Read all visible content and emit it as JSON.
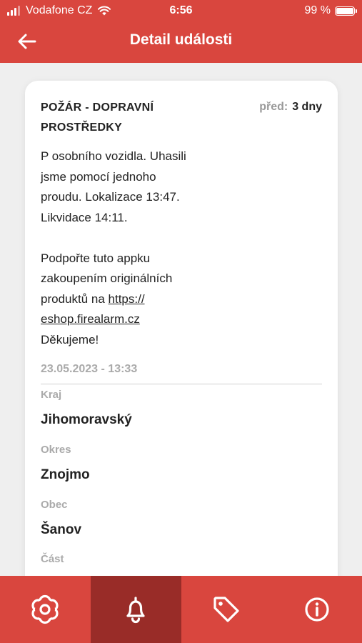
{
  "status_bar": {
    "carrier": "Vodafone CZ",
    "time": "6:56",
    "battery": "99 %",
    "battery_level": 0.99
  },
  "header": {
    "title": "Detail události"
  },
  "event": {
    "title": "POŽÁR - DOPRAVNÍ PROSTŘEDKY",
    "ago_label": "před:",
    "ago_value": "3 dny",
    "description_lines": [
      "P osobního vozidla. Uhasili",
      "jsme pomocí jednoho",
      "proudu. Lokalizace 13:47.",
      "Likvidace 14:11."
    ],
    "promo_lines": [
      "Podpořte tuto appku",
      "zakoupením originálních"
    ],
    "promo_pre_link": "produktů na ",
    "promo_link_part1": "https://",
    "promo_link_part2": "eshop.firealarm.cz",
    "promo_thanks": "Děkujeme!",
    "date": "23.05.2023 - 13:33"
  },
  "fields": [
    {
      "label": "Kraj",
      "value": "Jihomoravský"
    },
    {
      "label": "Okres",
      "value": "Znojmo"
    },
    {
      "label": "Obec",
      "value": "Šanov"
    },
    {
      "label": "Část",
      "value": ""
    }
  ],
  "nav": [
    {
      "icon": "settings-icon"
    },
    {
      "icon": "bell-icon",
      "active": true
    },
    {
      "icon": "tag-icon"
    },
    {
      "icon": "info-icon"
    }
  ],
  "colors": {
    "primary": "#d9463e",
    "primary_dark": "#992c28",
    "muted": "#aaaaaa"
  }
}
